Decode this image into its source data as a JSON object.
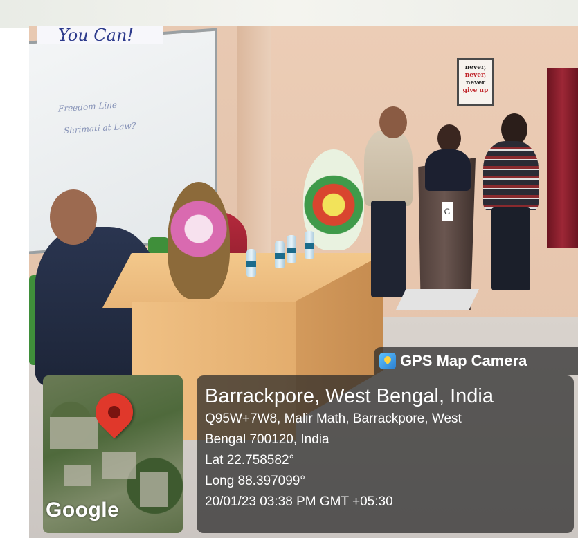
{
  "photo": {
    "banner_text": "You Can!",
    "whiteboard_lines": [
      "Freedom Line",
      "Shrimati at Law?"
    ],
    "poster_lines": [
      "never,",
      "never,",
      "never",
      "give up"
    ],
    "podium_logo": "C"
  },
  "gps_overlay": {
    "app_label": "GPS Map Camera",
    "place_title": "Barrackpore, West Bengal, India",
    "address_line_1": "Q95W+7W8, Malir Math, Barrackpore, West",
    "address_line_2": "Bengal 700120, India",
    "latitude": "Lat 22.758582°",
    "longitude": "Long 88.397099°",
    "timestamp": "20/01/23 03:38 PM GMT +05:30",
    "map_attribution": "Google",
    "colors": {
      "pin": "#e0382b",
      "card_bg": "#282828"
    },
    "icons": [
      "gps-map-camera-icon",
      "map-pin-icon"
    ]
  }
}
